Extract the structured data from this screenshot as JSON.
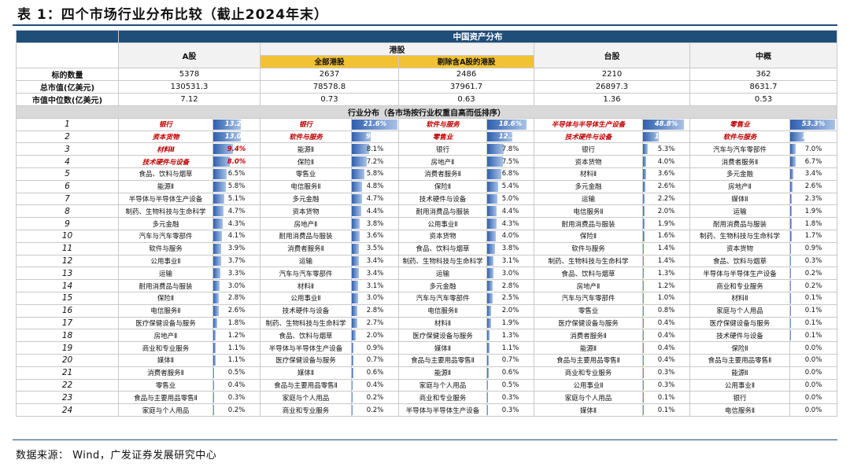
{
  "title": "表 1：四个市场行业分布比较（截止2024年末）",
  "footer": "数据来源：  Wind，广发证券发展研究中心",
  "band_title": "中国资产分布",
  "markets": {
    "a": "A股",
    "hk": "港股",
    "hk_all": "全部港股",
    "hk_ex": "剔除含A股的港股",
    "tw": "台股",
    "cc": "中概"
  },
  "summary_rows": [
    {
      "label": "标的数量",
      "values": [
        "5378",
        "2637",
        "2486",
        "2210",
        "362"
      ]
    },
    {
      "label": "总市值(亿美元)",
      "values": [
        "130531.3",
        "78578.8",
        "37961.7",
        "26897.3",
        "8631.7"
      ]
    },
    {
      "label": "市值中位数(亿美元)",
      "values": [
        "7.12",
        "0.73",
        "0.63",
        "1.36",
        "0.53"
      ]
    }
  ],
  "section_title": "行业分布（各市场按行业权重自高而低排序）",
  "bar_color": "#2f5fae",
  "rows": [
    {
      "rank": "1",
      "cells": [
        [
          "银行",
          "13.2%",
          0.132
        ],
        [
          "银行",
          "21.6%",
          0.216
        ],
        [
          "软件与服务",
          "18.6%",
          0.186
        ],
        [
          "半导体与半导体生产设备",
          "48.8%",
          0.488
        ],
        [
          "零售业",
          "53.3%",
          0.533
        ]
      ]
    },
    {
      "rank": "2",
      "cells": [
        [
          "资本货物",
          "13.0%",
          0.13
        ],
        [
          "软件与服务",
          "9.0%",
          0.09
        ],
        [
          "零售业",
          "12.1%",
          0.121
        ],
        [
          "技术硬件与设备",
          "18.6%",
          0.186
        ],
        [
          "软件与服务",
          "17.2%",
          0.172
        ]
      ]
    },
    {
      "rank": "3",
      "cells": [
        [
          "材料Ⅱ",
          "9.4%",
          0.094
        ],
        [
          "能源Ⅱ",
          "8.1%",
          0.081
        ],
        [
          "银行",
          "7.8%",
          0.078
        ],
        [
          "银行",
          "5.3%",
          0.053
        ],
        [
          "汽车与汽车零部件",
          "7.0%",
          0.07
        ]
      ]
    },
    {
      "rank": "4",
      "cells": [
        [
          "技术硬件与设备",
          "8.0%",
          0.08
        ],
        [
          "保险Ⅱ",
          "7.2%",
          0.072
        ],
        [
          "房地产Ⅱ",
          "7.5%",
          0.075
        ],
        [
          "资本货物",
          "4.0%",
          0.04
        ],
        [
          "消费者服务Ⅱ",
          "6.7%",
          0.067
        ]
      ]
    },
    {
      "rank": "5",
      "cells": [
        [
          "食品、饮料与烟草",
          "6.5%",
          0.065
        ],
        [
          "零售业",
          "5.8%",
          0.058
        ],
        [
          "消费者服务Ⅱ",
          "6.8%",
          0.068
        ],
        [
          "材料Ⅱ",
          "3.6%",
          0.036
        ],
        [
          "多元金融",
          "3.4%",
          0.034
        ]
      ]
    },
    {
      "rank": "6",
      "cells": [
        [
          "能源Ⅱ",
          "5.8%",
          0.058
        ],
        [
          "电信服务Ⅱ",
          "4.8%",
          0.048
        ],
        [
          "保险Ⅱ",
          "5.4%",
          0.054
        ],
        [
          "多元金融",
          "2.6%",
          0.026
        ],
        [
          "房地产Ⅱ",
          "2.6%",
          0.026
        ]
      ]
    },
    {
      "rank": "7",
      "cells": [
        [
          "半导体与半导体生产设备",
          "5.1%",
          0.051
        ],
        [
          "多元金融",
          "4.7%",
          0.047
        ],
        [
          "技术硬件与设备",
          "5.0%",
          0.05
        ],
        [
          "运输",
          "2.2%",
          0.022
        ],
        [
          "媒体Ⅱ",
          "2.3%",
          0.023
        ]
      ]
    },
    {
      "rank": "8",
      "cells": [
        [
          "制药、生物科技与生命科学",
          "4.7%",
          0.047
        ],
        [
          "资本货物",
          "4.4%",
          0.044
        ],
        [
          "耐用消费品与服装",
          "4.4%",
          0.044
        ],
        [
          "电信服务Ⅱ",
          "2.0%",
          0.02
        ],
        [
          "运输",
          "1.9%",
          0.019
        ]
      ]
    },
    {
      "rank": "9",
      "cells": [
        [
          "多元金融",
          "4.3%",
          0.043
        ],
        [
          "房地产Ⅱ",
          "3.8%",
          0.038
        ],
        [
          "公用事业Ⅱ",
          "4.3%",
          0.043
        ],
        [
          "耐用消费品与服装",
          "1.9%",
          0.019
        ],
        [
          "耐用消费品与服装",
          "1.8%",
          0.018
        ]
      ]
    },
    {
      "rank": "10",
      "cells": [
        [
          "汽车与汽车零部件",
          "4.1%",
          0.041
        ],
        [
          "耐用消费品与服装",
          "3.6%",
          0.036
        ],
        [
          "资本货物",
          "4.0%",
          0.04
        ],
        [
          "保险Ⅱ",
          "1.6%",
          0.016
        ],
        [
          "制药、生物科技与生命科学",
          "1.7%",
          0.017
        ]
      ]
    },
    {
      "rank": "11",
      "cells": [
        [
          "软件与服务",
          "3.9%",
          0.039
        ],
        [
          "消费者服务Ⅱ",
          "3.5%",
          0.035
        ],
        [
          "食品、饮料与烟草",
          "3.8%",
          0.038
        ],
        [
          "软件与服务",
          "1.4%",
          0.014
        ],
        [
          "资本货物",
          "0.9%",
          0.009
        ]
      ]
    },
    {
      "rank": "12",
      "cells": [
        [
          "公用事业Ⅱ",
          "3.7%",
          0.037
        ],
        [
          "运输",
          "3.4%",
          0.034
        ],
        [
          "制药、生物科技与生命科学",
          "3.1%",
          0.031
        ],
        [
          "制药、生物科技与生命科学",
          "1.4%",
          0.014
        ],
        [
          "食品、饮料与烟草",
          "0.3%",
          0.003
        ]
      ]
    },
    {
      "rank": "13",
      "cells": [
        [
          "运输",
          "3.3%",
          0.033
        ],
        [
          "汽车与汽车零部件",
          "3.4%",
          0.034
        ],
        [
          "运输",
          "3.0%",
          0.03
        ],
        [
          "食品、饮料与烟草",
          "1.3%",
          0.013
        ],
        [
          "半导体与半导体生产设备",
          "0.2%",
          0.002
        ]
      ]
    },
    {
      "rank": "14",
      "cells": [
        [
          "耐用消费品与服装",
          "3.0%",
          0.03
        ],
        [
          "材料Ⅱ",
          "3.1%",
          0.031
        ],
        [
          "多元金融",
          "2.8%",
          0.028
        ],
        [
          "房地产Ⅱ",
          "1.2%",
          0.012
        ],
        [
          "商业和专业服务",
          "0.2%",
          0.002
        ]
      ]
    },
    {
      "rank": "15",
      "cells": [
        [
          "保险Ⅱ",
          "2.8%",
          0.028
        ],
        [
          "公用事业Ⅱ",
          "3.0%",
          0.03
        ],
        [
          "汽车与汽车零部件",
          "2.5%",
          0.025
        ],
        [
          "汽车与汽车零部件",
          "1.0%",
          0.01
        ],
        [
          "材料Ⅱ",
          "0.1%",
          0.001
        ]
      ]
    },
    {
      "rank": "16",
      "cells": [
        [
          "电信服务Ⅱ",
          "2.6%",
          0.026
        ],
        [
          "技术硬件与设备",
          "2.8%",
          0.028
        ],
        [
          "电信服务Ⅱ",
          "2.0%",
          0.02
        ],
        [
          "零售业",
          "0.8%",
          0.008
        ],
        [
          "家庭与个人用品",
          "0.1%",
          0.001
        ]
      ]
    },
    {
      "rank": "17",
      "cells": [
        [
          "医疗保健设备与服务",
          "1.8%",
          0.018
        ],
        [
          "制药、生物科技与生命科学",
          "2.7%",
          0.027
        ],
        [
          "材料Ⅱ",
          "1.9%",
          0.019
        ],
        [
          "医疗保健设备与服务",
          "0.4%",
          0.004
        ],
        [
          "医疗保健设备与服务",
          "0.1%",
          0.001
        ]
      ]
    },
    {
      "rank": "18",
      "cells": [
        [
          "房地产Ⅱ",
          "1.2%",
          0.012
        ],
        [
          "食品、饮料与烟草",
          "2.0%",
          0.02
        ],
        [
          "医疗保健设备与服务",
          "1.3%",
          0.013
        ],
        [
          "消费者服务Ⅱ",
          "0.4%",
          0.004
        ],
        [
          "技术硬件与设备",
          "0.1%",
          0.001
        ]
      ]
    },
    {
      "rank": "19",
      "cells": [
        [
          "商业和专业服务",
          "1.1%",
          0.011
        ],
        [
          "半导体与半导体生产设备",
          "0.9%",
          0.009
        ],
        [
          "媒体Ⅱ",
          "1.1%",
          0.011
        ],
        [
          "能源Ⅱ",
          "0.4%",
          0.004
        ],
        [
          "保险Ⅱ",
          "0.0%",
          0.0
        ]
      ]
    },
    {
      "rank": "20",
      "cells": [
        [
          "媒体Ⅱ",
          "1.1%",
          0.011
        ],
        [
          "医疗保健设备与服务",
          "0.7%",
          0.007
        ],
        [
          "食品与主要用品零售Ⅱ",
          "0.7%",
          0.007
        ],
        [
          "食品与主要用品零售Ⅱ",
          "0.4%",
          0.004
        ],
        [
          "食品与主要用品零售Ⅱ",
          "0.0%",
          0.0
        ]
      ]
    },
    {
      "rank": "21",
      "cells": [
        [
          "消费者服务Ⅱ",
          "0.5%",
          0.005
        ],
        [
          "媒体Ⅱ",
          "0.6%",
          0.006
        ],
        [
          "能源Ⅱ",
          "0.6%",
          0.006
        ],
        [
          "商业和专业服务",
          "0.3%",
          0.003
        ],
        [
          "能源Ⅱ",
          "0.0%",
          0.0
        ]
      ]
    },
    {
      "rank": "22",
      "cells": [
        [
          "零售业",
          "0.4%",
          0.004
        ],
        [
          "食品与主要用品零售Ⅱ",
          "0.4%",
          0.004
        ],
        [
          "家庭与个人用品",
          "0.5%",
          0.005
        ],
        [
          "公用事业Ⅱ",
          "0.3%",
          0.003
        ],
        [
          "公用事业Ⅱ",
          "0.0%",
          0.0
        ]
      ]
    },
    {
      "rank": "23",
      "cells": [
        [
          "食品与主要用品零售Ⅱ",
          "0.3%",
          0.003
        ],
        [
          "家庭与个人用品",
          "0.2%",
          0.002
        ],
        [
          "商业和专业服务",
          "0.3%",
          0.003
        ],
        [
          "家庭与个人用品",
          "0.1%",
          0.001
        ],
        [
          "银行",
          "0.0%",
          0.0
        ]
      ]
    },
    {
      "rank": "24",
      "cells": [
        [
          "家庭与个人用品",
          "0.2%",
          0.002
        ],
        [
          "商业和专业服务",
          "0.2%",
          0.002
        ],
        [
          "半导体与半导体生产设备",
          "0.3%",
          0.003
        ],
        [
          "媒体Ⅱ",
          "0.1%",
          0.001
        ],
        [
          "电信服务Ⅱ",
          "0.0%",
          0.0
        ]
      ]
    }
  ]
}
